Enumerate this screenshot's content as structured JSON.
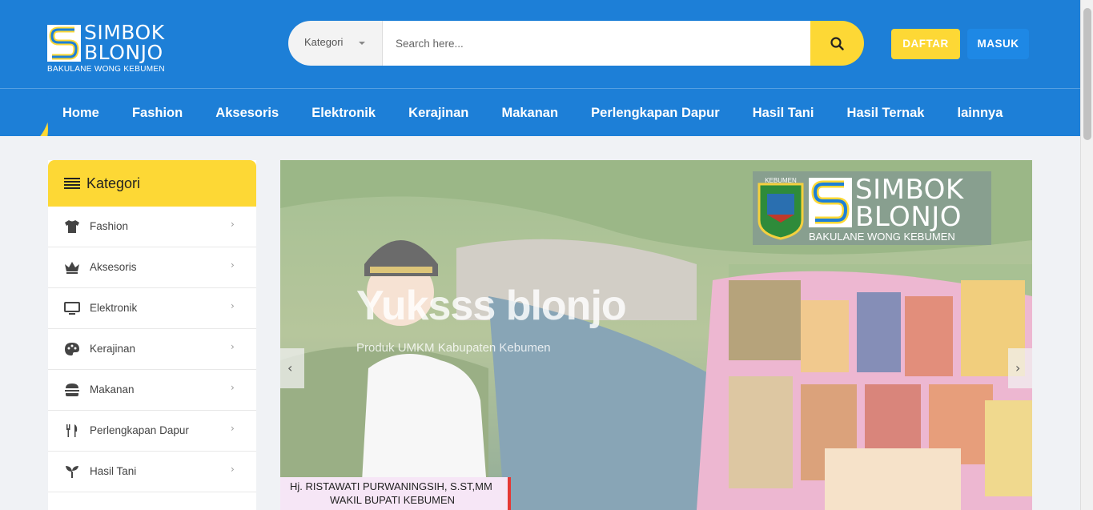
{
  "brand": {
    "title_line1": "SIMBOK",
    "title_line2": "BLONJO",
    "tagline": "BAKULANE WONG KEBUMEN"
  },
  "search": {
    "category_label": "Kategori",
    "placeholder": "Search here..."
  },
  "auth": {
    "register_label": "DAFTAR",
    "login_label": "MASUK"
  },
  "nav": {
    "items": [
      {
        "label": "Home"
      },
      {
        "label": "Fashion"
      },
      {
        "label": "Aksesoris"
      },
      {
        "label": "Elektronik"
      },
      {
        "label": "Kerajinan"
      },
      {
        "label": "Makanan"
      },
      {
        "label": "Perlengkapan Dapur"
      },
      {
        "label": "Hasil Tani"
      },
      {
        "label": "Hasil Ternak"
      },
      {
        "label": "lainnya"
      }
    ]
  },
  "sidebar": {
    "title": "Kategori",
    "items": [
      {
        "label": "Fashion",
        "icon": "shirt-icon"
      },
      {
        "label": "Aksesoris",
        "icon": "crown-icon"
      },
      {
        "label": "Elektronik",
        "icon": "monitor-icon"
      },
      {
        "label": "Kerajinan",
        "icon": "palette-icon"
      },
      {
        "label": "Makanan",
        "icon": "burger-icon"
      },
      {
        "label": "Perlengkapan Dapur",
        "icon": "utensils-icon"
      },
      {
        "label": "Hasil Tani",
        "icon": "seedling-icon"
      }
    ]
  },
  "banner": {
    "title": "Yuksss blonjo",
    "subtitle": "Produk UMKM Kabupaten Kebumen",
    "caption_line1": "Hj. RISTAWATI PURWANINGSIH, S.ST,MM",
    "caption_line2": "WAKIL BUPATI KEBUMEN",
    "crest_text": "KEBUMEN",
    "brand_title_line1": "SIMBOK",
    "brand_title_line2": "BLONJO",
    "brand_tagline": "BAKULANE WONG KEBUMEN"
  },
  "colors": {
    "primary": "#1d7fd7",
    "accent": "#fdd835",
    "login": "#1e88e5"
  }
}
